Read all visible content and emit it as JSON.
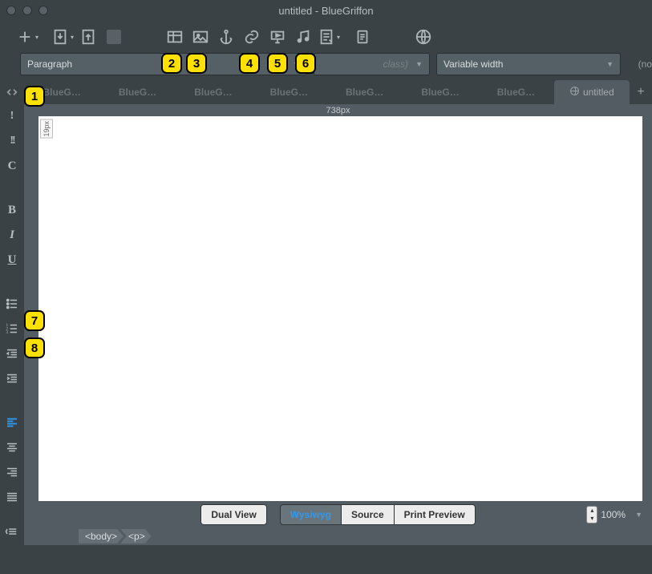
{
  "window": {
    "title": "untitled - BlueGriffon"
  },
  "dropdowns": {
    "paragraph": "Paragraph",
    "class_placeholder": "class)",
    "font": "Variable width",
    "end_hint": "(no"
  },
  "tabs": {
    "items": [
      {
        "label": "BlueG…"
      },
      {
        "label": "BlueG…"
      },
      {
        "label": "BlueG…"
      },
      {
        "label": "BlueG…"
      },
      {
        "label": "BlueG…"
      },
      {
        "label": "BlueG…"
      },
      {
        "label": "BlueG…"
      }
    ],
    "active_label": "untitled"
  },
  "ruler": {
    "width_label": "738px"
  },
  "mini_badge": "19px",
  "view_buttons": {
    "dual": "Dual View",
    "wysiwyg": "Wysiwyg",
    "source": "Source",
    "preview": "Print Preview"
  },
  "zoom": {
    "value": "100%"
  },
  "breadcrumb": {
    "body": "<body>",
    "p": "<p>"
  },
  "badges": {
    "b1": "1",
    "b2": "2",
    "b3": "3",
    "b4": "4",
    "b5": "5",
    "b6": "6",
    "b7": "7",
    "b8": "8"
  }
}
